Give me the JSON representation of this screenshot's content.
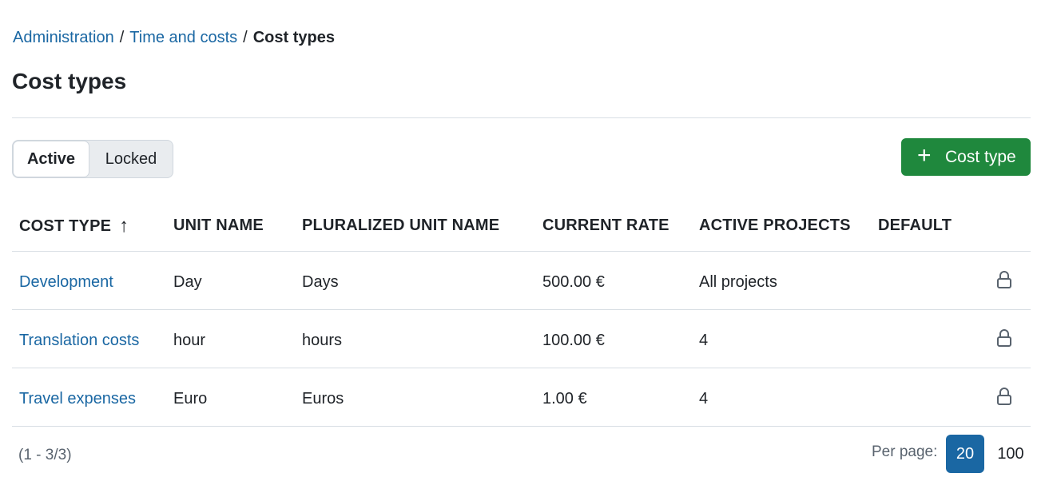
{
  "breadcrumb": {
    "items": [
      "Administration",
      "Time and costs"
    ],
    "separator": "/",
    "current": "Cost types"
  },
  "page_title": "Cost types",
  "filter_tabs": {
    "active": "Active",
    "locked": "Locked"
  },
  "add_button": {
    "icon": "+",
    "label": "Cost type"
  },
  "table": {
    "columns": [
      "COST TYPE",
      "UNIT NAME",
      "PLURALIZED UNIT NAME",
      "CURRENT RATE",
      "ACTIVE PROJECTS",
      "DEFAULT"
    ],
    "sort_icon": "↑",
    "rows": [
      {
        "cost_type": "Development",
        "unit_name": "Day",
        "pluralized_unit_name": "Days",
        "current_rate": "500.00 €",
        "active_projects": "All projects"
      },
      {
        "cost_type": "Translation costs",
        "unit_name": "hour",
        "pluralized_unit_name": "hours",
        "current_rate": "100.00 €",
        "active_projects": "4"
      },
      {
        "cost_type": "Travel expenses",
        "unit_name": "Euro",
        "pluralized_unit_name": "Euros",
        "current_rate": "1.00 €",
        "active_projects": "4"
      }
    ],
    "row_action_icon": "lock-icon"
  },
  "footer": {
    "count": "(1 - 3/3)",
    "per_page_label": "Per page:",
    "per_page_options": [
      "20",
      "100"
    ],
    "per_page_selected": "20"
  },
  "colors": {
    "link": "#1a67a3",
    "primary_button": "#1f883d",
    "pagination_active": "#1a67a3",
    "border": "#d8dee4"
  }
}
